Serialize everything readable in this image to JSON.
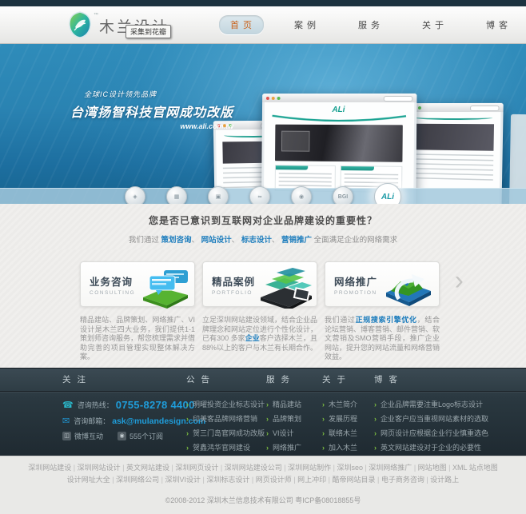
{
  "icons": {
    "phone": "☎",
    "mail": "✉",
    "weibo": "◫",
    "rss": "◉",
    "arrow": "›",
    "chevron": "›",
    "tm": "™"
  },
  "header": {
    "logo_text": "木兰设计",
    "nav": [
      {
        "label": "首页",
        "cls": "active"
      },
      {
        "label": "案例"
      },
      {
        "label": "服务"
      },
      {
        "label": "关于"
      },
      {
        "label": "博客"
      }
    ],
    "huaban_tooltip": "采集到花瓣"
  },
  "banner": {
    "tagline": "全球IC设计领先品牌",
    "title": "台湾扬智科技官网成功改版",
    "url": "www.ali.com.tw",
    "site_logo": "ALi",
    "indicators": [
      {
        "glyph": "◈"
      },
      {
        "glyph": "▦"
      },
      {
        "glyph": "▣"
      },
      {
        "glyph": "∞"
      },
      {
        "glyph": "◉"
      },
      {
        "glyph": "BGI"
      },
      {
        "glyph": "ALi",
        "cls": "active"
      }
    ]
  },
  "intro": {
    "heading": "您是否已意识到互联网对企业品牌建设的重要性？",
    "parts": [
      {
        "t": "我们通过 "
      },
      {
        "t": "策划咨询",
        "cls": "hl"
      },
      {
        "t": "、 "
      },
      {
        "t": "网站设计",
        "cls": "hl"
      },
      {
        "t": "、 "
      },
      {
        "t": "标志设计",
        "cls": "hl"
      },
      {
        "t": "、 "
      },
      {
        "t": "营销推广",
        "cls": "hl"
      },
      {
        "t": " 全面满足企业的网络需求"
      }
    ]
  },
  "cards": [
    {
      "title": "业务咨询",
      "subtitle": "CONSULTING",
      "desc_parts": [
        {
          "t": "精品建站、品牌策划、网络推广、VI设计是木兰四大业务，我们提供1-1策划师咨询服务，帮您梳理需求并借助完善的项目管理实现整体解决方案。"
        }
      ]
    },
    {
      "title": "精品案例",
      "subtitle": "PORTFOLIO",
      "desc_parts": [
        {
          "t": "立足深圳网站建设领域，结合企业品牌理念和网站定位进行个性化设计，已有300 多家"
        },
        {
          "t": "企业",
          "cls": "hl"
        },
        {
          "t": "客户选择木兰，且88%以上的客户与木兰有长期合作。"
        }
      ]
    },
    {
      "title": "网络推广",
      "subtitle": "PROMOTION",
      "desc_parts": [
        {
          "t": "我们通过"
        },
        {
          "t": "正规搜索引擎优化",
          "cls": "hl"
        },
        {
          "t": "，结合论坛营销、博客营销、邮件营销、软文营销及SMO营销手段，推广企业网站，提升您的网站流量和网络营销效益。"
        }
      ]
    }
  ],
  "footer": {
    "follow_title": "关注",
    "notice_title": "公告",
    "services_title": "服务",
    "about_title": "关于",
    "blog_title": "博客",
    "hotline_label": "咨询热线：",
    "hotline_value": "0755-8278 4400",
    "email_label": "咨询邮箱：",
    "email_value": "ask@mulandesign.com",
    "weibo_label": "微博互动",
    "rss_label": "555个订阅",
    "notices": [
      "明曜投资企业标志设计",
      "印美客品牌网络营销",
      "贺三门岛官网成功改版",
      "贺鑫鸿华官网建设"
    ],
    "services": [
      "精品建站",
      "品牌策划",
      "VI设计",
      "网络推广"
    ],
    "about": [
      "木兰简介",
      "发展历程",
      "联络木兰",
      "加入木兰"
    ],
    "blog": [
      "企业品牌需要注重Logo标志设计",
      "企业客户应当重视网站素材的选取",
      "网页设计应根据企业行业慎重选色",
      "英文网站建设对于企业的必要性"
    ]
  },
  "bottom": {
    "links_row1": [
      "深圳网站建设",
      "深圳网站设计",
      "英文网站建设",
      "深圳网页设计",
      "深圳网站建设公司",
      "深圳网站制作",
      "深圳seo",
      "深圳网络推广",
      "网站地图",
      "XML 站点地图"
    ],
    "links_row2": [
      "设计网址大全",
      "深圳网络公司",
      "深圳VI设计",
      "深圳标志设计",
      "网页设计师",
      "网上冲印",
      "酷帝网站目录",
      "电子商务咨询",
      "设计路上"
    ],
    "copyright": "©2008-2012 深圳木兰信息技术有限公司 粤ICP备08018855号"
  }
}
